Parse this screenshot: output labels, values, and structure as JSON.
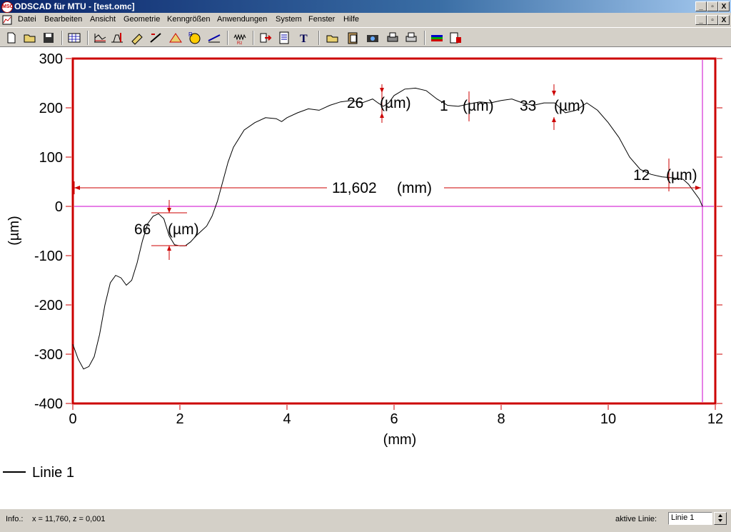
{
  "window": {
    "title": "ODSCAD für MTU - [test.omc]",
    "app_logo_text": "MSC",
    "title_buttons": [
      "_",
      "▫",
      "X"
    ],
    "doc_buttons": [
      "_",
      "▫",
      "X"
    ]
  },
  "menu": {
    "items": [
      "Datei",
      "Bearbeiten",
      "Ansicht",
      "Geometrie",
      "Kenngrößen",
      "Anwendungen",
      "System",
      "Fenster",
      "Hilfe"
    ]
  },
  "toolbar": {
    "icons": [
      "new-file-icon",
      "open-folder-icon",
      "save-disk-icon",
      "table-icon",
      "profile-measure-icon",
      "trapezoid-icon",
      "ruler-icon",
      "slope-icon",
      "angle-icon",
      "radius-icon",
      "line-fit-icon",
      "roughness-icon",
      "export-arrow-icon",
      "report-icon",
      "text-icon",
      "open-file-icon",
      "clipboard-icon",
      "camera-icon",
      "print-preview-icon",
      "printer-icon",
      "color-chart-icon",
      "settings-icon"
    ]
  },
  "colors": {
    "frame": "#cc0000",
    "annotation": "#cc0000",
    "curve": "#000000",
    "zero_line": "#cc00cc",
    "cursor_line": "#cc00cc"
  },
  "chart_data": {
    "type": "line",
    "xlabel": "(mm)",
    "ylabel": "(µm)",
    "xlim": [
      0,
      12
    ],
    "ylim": [
      -400,
      300
    ],
    "xticks": [
      "0",
      "2",
      "4",
      "6",
      "8",
      "10",
      "12"
    ],
    "yticks": [
      "300",
      "200",
      "100",
      "0",
      "-100",
      "-200",
      "-300",
      "-400"
    ],
    "series": [
      {
        "name": "Linie 1",
        "x": [
          0,
          0.1,
          0.2,
          0.3,
          0.4,
          0.5,
          0.6,
          0.7,
          0.8,
          0.9,
          1.0,
          1.1,
          1.2,
          1.3,
          1.4,
          1.5,
          1.6,
          1.7,
          1.8,
          1.9,
          2.0,
          2.1,
          2.2,
          2.3,
          2.4,
          2.5,
          2.6,
          2.7,
          2.8,
          2.9,
          3.0,
          3.2,
          3.4,
          3.6,
          3.8,
          3.9,
          4.0,
          4.2,
          4.4,
          4.6,
          4.8,
          5.0,
          5.2,
          5.4,
          5.6,
          5.7,
          5.8,
          5.9,
          6.0,
          6.2,
          6.4,
          6.6,
          6.8,
          7.0,
          7.2,
          7.4,
          7.6,
          7.8,
          8.0,
          8.2,
          8.4,
          8.6,
          8.8,
          9.0,
          9.2,
          9.4,
          9.6,
          9.8,
          10.0,
          10.2,
          10.4,
          10.6,
          10.8,
          11.0,
          11.2,
          11.4,
          11.5,
          11.6,
          11.7,
          11.76
        ],
        "y": [
          -280,
          -310,
          -330,
          -325,
          -305,
          -260,
          -200,
          -155,
          -140,
          -145,
          -160,
          -150,
          -115,
          -70,
          -35,
          -20,
          -15,
          -25,
          -60,
          -78,
          -80,
          -80,
          -72,
          -60,
          -50,
          -40,
          -20,
          10,
          50,
          90,
          120,
          155,
          170,
          180,
          178,
          172,
          180,
          190,
          198,
          195,
          205,
          212,
          215,
          210,
          218,
          210,
          203,
          210,
          225,
          238,
          240,
          235,
          218,
          205,
          203,
          208,
          212,
          210,
          215,
          218,
          210,
          205,
          210,
          210,
          190,
          195,
          210,
          195,
          170,
          140,
          100,
          75,
          65,
          60,
          58,
          55,
          45,
          30,
          15,
          0
        ]
      }
    ],
    "annotations": [
      {
        "value": "66",
        "unit": "(µm)"
      },
      {
        "value": "26",
        "unit": "(µm)"
      },
      {
        "value": "1",
        "unit": "(µm)"
      },
      {
        "value": "33",
        "unit": "(µm)"
      },
      {
        "value": "12",
        "unit": "(µm)"
      },
      {
        "value": "11,602",
        "unit": "(mm)"
      }
    ],
    "legend_position": "bottom-left",
    "grid": false
  },
  "statusbar": {
    "info_label": "Info.:",
    "coords": "x = 11,760, z = 0,001",
    "active_line_label": "aktive Linie:",
    "active_line_value": "Linie 1"
  }
}
